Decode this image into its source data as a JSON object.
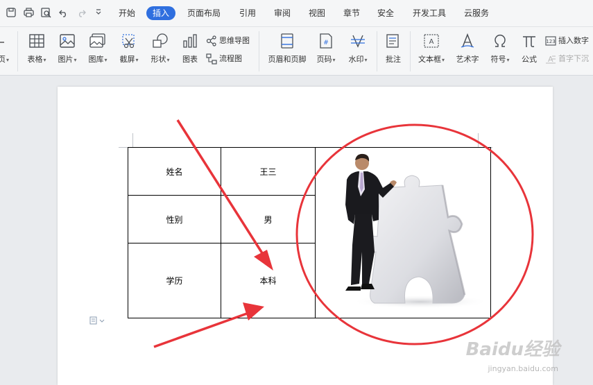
{
  "menubar": {
    "quick_icons": [
      "save-icon",
      "print-icon",
      "print-preview-icon",
      "undo-icon",
      "redo-icon",
      "more-icon"
    ],
    "tabs": [
      {
        "label": "开始",
        "active": false
      },
      {
        "label": "插入",
        "active": true
      },
      {
        "label": "页面布局",
        "active": false
      },
      {
        "label": "引用",
        "active": false
      },
      {
        "label": "审阅",
        "active": false
      },
      {
        "label": "视图",
        "active": false
      },
      {
        "label": "章节",
        "active": false
      },
      {
        "label": "安全",
        "active": false
      },
      {
        "label": "开发工具",
        "active": false
      },
      {
        "label": "云服务",
        "active": false
      }
    ]
  },
  "ribbon": {
    "partial_left": "页",
    "table": "表格",
    "picture": "图片",
    "gallery": "图库",
    "screenshot": "截屏",
    "shape": "形状",
    "chart": "图表",
    "mindmap": "思维导图",
    "flowchart": "流程图",
    "header_footer": "页眉和页脚",
    "page_number": "页码",
    "watermark": "水印",
    "comment": "批注",
    "textbox": "文本框",
    "wordart": "艺术字",
    "symbol": "符号",
    "formula": "公式",
    "insert_number": "插入数字",
    "drop_cap": "首字下沉"
  },
  "document": {
    "table": {
      "rows": [
        {
          "label": "姓名",
          "value": "王三"
        },
        {
          "label": "性别",
          "value": "男"
        },
        {
          "label": "学历",
          "value": "本科"
        }
      ]
    }
  },
  "watermark": {
    "brand": "Baidu经验",
    "url": "jingyan.baidu.com"
  },
  "colors": {
    "accent": "#2f6fdf",
    "annotation": "#e8343a"
  }
}
